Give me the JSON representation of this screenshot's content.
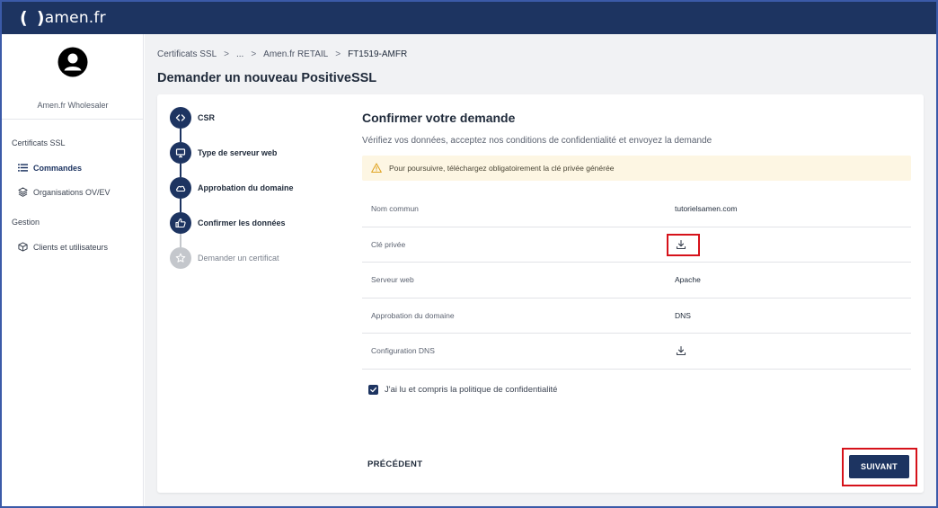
{
  "brand": {
    "logo_left": "(",
    "logo_right": ")",
    "logo_text": "amen.fr"
  },
  "sidebar": {
    "org_name": "Amen.fr Wholesaler",
    "sections": [
      {
        "title": "Certificats SSL",
        "items": [
          {
            "label": "Commandes",
            "icon": "list-icon",
            "active": true
          },
          {
            "label": "Organisations OV/EV",
            "icon": "layers-icon",
            "active": false
          }
        ]
      },
      {
        "title": "Gestion",
        "items": [
          {
            "label": "Clients et utilisateurs",
            "icon": "cube-icon",
            "active": false
          }
        ]
      }
    ]
  },
  "breadcrumb": {
    "items": [
      "Certificats SSL",
      "...",
      "Amen.fr RETAIL",
      "FT1519-AMFR"
    ],
    "separator": ">"
  },
  "page_title": "Demander un nouveau PositiveSSL",
  "steps": [
    {
      "label": "CSR",
      "icon": "code-icon",
      "state": "done"
    },
    {
      "label": "Type de serveur web",
      "icon": "monitor-icon",
      "state": "done"
    },
    {
      "label": "Approbation du domaine",
      "icon": "cloud-icon",
      "state": "done"
    },
    {
      "label": "Confirmer les données",
      "icon": "thumbs-up-icon",
      "state": "current"
    },
    {
      "label": "Demander un certificat",
      "icon": "star-icon",
      "state": "pending"
    }
  ],
  "confirm": {
    "title": "Confirmer votre demande",
    "subtitle": "Vérifiez vos données, acceptez nos conditions de confidentialité et envoyez la demande",
    "warning": "Pour poursuivre, téléchargez obligatoirement la clé privée générée",
    "rows": [
      {
        "label": "Nom commun",
        "value": "tutorielsamen.com"
      },
      {
        "label": "Clé privée",
        "value": null,
        "download": true
      },
      {
        "label": "Serveur web",
        "value": "Apache"
      },
      {
        "label": "Approbation du domaine",
        "value": "DNS"
      },
      {
        "label": "Configuration DNS",
        "value": null,
        "download": true
      }
    ],
    "consent_label": "J'ai lu et compris la politique de confidentialité",
    "consent_checked": true
  },
  "actions": {
    "prev_label": "PRÉCÉDENT",
    "next_label": "SUIVANT"
  },
  "colors": {
    "navy": "#1d3461",
    "highlight": "#d6121a",
    "warning_bg": "#fdf6e3",
    "warning_icon": "#e0a526"
  }
}
